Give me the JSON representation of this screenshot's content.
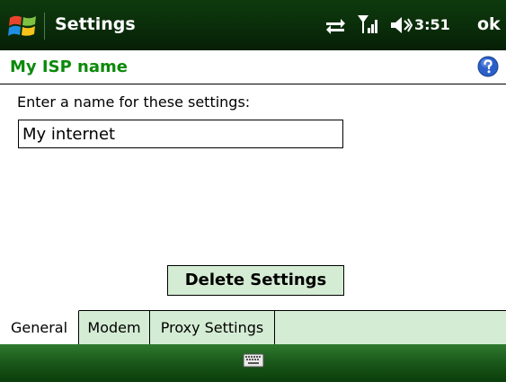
{
  "titlebar": {
    "app_title": "Settings",
    "clock": "3:51",
    "ok_label": "ok",
    "icons": [
      "windows-start-icon",
      "sync-icon",
      "signal-icon",
      "volume-icon"
    ]
  },
  "header": {
    "title": "My ISP name",
    "help_icon": "help-icon"
  },
  "form": {
    "prompt": "Enter a name for these settings:",
    "name_value": "My internet"
  },
  "actions": {
    "delete_label": "Delete Settings"
  },
  "tabs": [
    {
      "label": "General",
      "active": true
    },
    {
      "label": "Modem",
      "active": false
    },
    {
      "label": "Proxy Settings",
      "active": false
    }
  ],
  "softkeys": {
    "icon": "keyboard-icon"
  },
  "colors": {
    "titlebar_bg": "#0a2d0a",
    "header_text": "#0a8a0a",
    "tab_strip": "#d4ecd4",
    "button_bg": "#d4ecd4",
    "softkey_bg": "#1b5a1b",
    "help_blue": "#2b5fc9"
  }
}
